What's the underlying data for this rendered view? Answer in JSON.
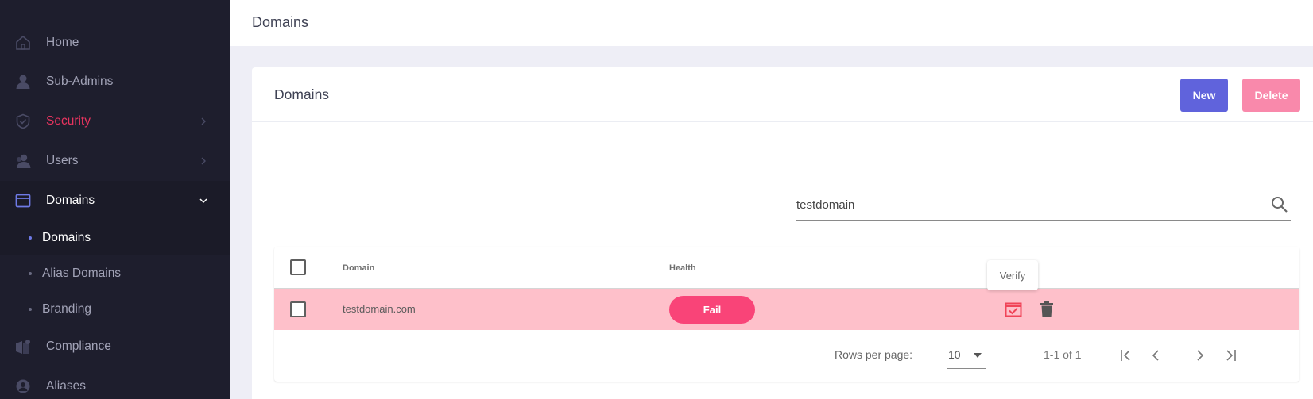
{
  "sidebar": {
    "items": [
      {
        "label": "Home",
        "icon": "home-icon"
      },
      {
        "label": "Sub-Admins",
        "icon": "user-icon"
      },
      {
        "label": "Security",
        "icon": "shield-icon"
      },
      {
        "label": "Users",
        "icon": "users-icon"
      },
      {
        "label": "Domains",
        "icon": "browser-window-icon"
      },
      {
        "label": "Compliance",
        "icon": "compliance-icon"
      },
      {
        "label": "Aliases",
        "icon": "aliases-icon"
      }
    ],
    "sub_items": [
      {
        "label": "Domains"
      },
      {
        "label": "Alias Domains"
      },
      {
        "label": "Branding"
      }
    ]
  },
  "header": {
    "title": "Domains"
  },
  "card": {
    "title": "Domains",
    "new_label": "New",
    "delete_label": "Delete"
  },
  "search": {
    "value": "testdomain"
  },
  "table": {
    "columns": [
      "Domain",
      "Health"
    ],
    "rows": [
      {
        "domain": "testdomain.com",
        "health": "Fail"
      }
    ],
    "tooltip": "Verify"
  },
  "pagination": {
    "rows_per_page_label": "Rows per page:",
    "rows_per_page": "10",
    "range": "1-1 of 1"
  },
  "colors": {
    "sidebar_bg": "#1e1e2d",
    "accent": "#6063dc",
    "danger": "#f94478",
    "row_highlight": "#fec0ca"
  }
}
